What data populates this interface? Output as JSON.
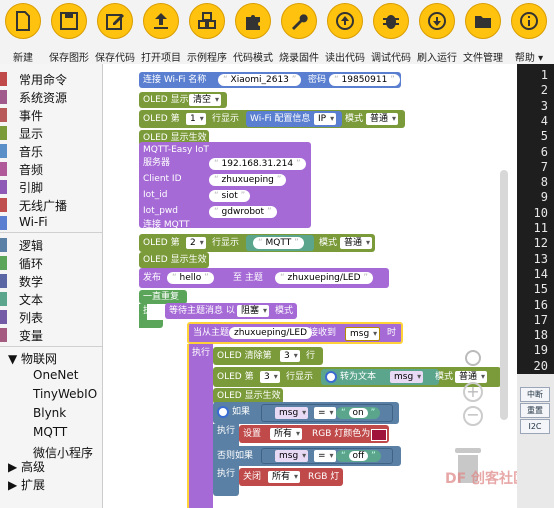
{
  "toolbar": {
    "buttons": [
      {
        "label": "新建",
        "icon": "new-file-icon"
      },
      {
        "label": "保存图形",
        "icon": "save-icon"
      },
      {
        "label": "保存代码",
        "icon": "edit-icon"
      },
      {
        "label": "打开项目",
        "icon": "upload-icon"
      },
      {
        "label": "示例程序",
        "icon": "blocks-icon"
      },
      {
        "label": "代码模式",
        "icon": "puzzle-icon"
      },
      {
        "label": "烧录固件",
        "icon": "wrench-icon"
      },
      {
        "label": "读出代码",
        "icon": "circle-up-icon"
      },
      {
        "label": "调试代码",
        "icon": "bug-icon"
      },
      {
        "label": "刷入运行",
        "icon": "circle-down-icon"
      },
      {
        "label": "文件管理",
        "icon": "folder-icon"
      },
      {
        "label": "帮助 ▾",
        "icon": "info-icon"
      }
    ]
  },
  "sidebar": {
    "categories": [
      {
        "label": "常用命令",
        "color": "#c04a4a"
      },
      {
        "label": "系统资源",
        "color": "#a05a8c"
      },
      {
        "label": "事件",
        "color": "#b85a5a"
      },
      {
        "label": "显示",
        "color": "#7b9b3a"
      },
      {
        "label": "音乐",
        "color": "#5b8fc7"
      },
      {
        "label": "音频",
        "color": "#b05a9a"
      },
      {
        "label": "引脚",
        "color": "#8e5ab5"
      },
      {
        "label": "无线广播",
        "color": "#c05050"
      },
      {
        "label": "Wi-Fi",
        "color": "#5a7fd0"
      },
      {
        "label": "逻辑",
        "color": "#5b80a5"
      },
      {
        "label": "循环",
        "color": "#5ba55b"
      },
      {
        "label": "数学",
        "color": "#5b67a5"
      },
      {
        "label": "文本",
        "color": "#5ba58c"
      },
      {
        "label": "列表",
        "color": "#745ba5"
      },
      {
        "label": "变量",
        "color": "#a55b80"
      }
    ],
    "iot_group": "▼ 物联网",
    "iot_items": [
      "OneNet",
      "TinyWebIO",
      "Blynk",
      "MQTT",
      "微信小程序"
    ],
    "advanced": "▶ 高级",
    "extension": "▶ 扩展"
  },
  "blocks": {
    "wifi": {
      "label": "连接 Wi-Fi 名称",
      "ssid": "Xiaomi_2613",
      "pwd_label": "密码",
      "pwd": "19850911"
    },
    "oled_clear": {
      "label": "OLED 显示",
      "opt": "清空"
    },
    "oled_wifi": {
      "pre": "OLED 第",
      "line": "1",
      "mid": "行显示",
      "info": "Wi-Fi 配置信息",
      "ip": "IP",
      "mode_label": "模式",
      "mode": "普通"
    },
    "oled_apply1": "OLED 显示生效",
    "mqtt": {
      "title": "MQTT-Easy IoT",
      "server_label": "服务器",
      "server": "192.168.31.214",
      "client_label": "Client ID",
      "client": "zhuxueping",
      "iotid_label": "Iot_id",
      "iotid": "siot",
      "iotpwd_label": "Iot_pwd",
      "iotpwd": "gdwrobot",
      "connect": "连接 MQTT"
    },
    "oled_mqtt": {
      "pre": "OLED 第",
      "line": "2",
      "mid": "行显示",
      "text": "MQTT",
      "mode_label": "模式",
      "mode": "普通"
    },
    "oled_apply2": "OLED 显示生效",
    "publish": {
      "label": "发布",
      "msg": "hello",
      "mid": "至 主题",
      "topic": "zhuxueping/LED"
    },
    "forever": "一直重复",
    "exec": "执行",
    "wait": {
      "label": "等待主题消息 以",
      "mode": "阻塞",
      "suffix": "模式"
    },
    "on_msg": {
      "label": "当从主题",
      "topic": "zhuxueping/LED",
      "mid": "接收到",
      "var": "msg",
      "suffix": "时"
    },
    "exec2": "执行",
    "oled_clear_line": {
      "label": "OLED 清除第",
      "line": "3",
      "suffix": "行"
    },
    "oled_line3": {
      "pre": "OLED 第",
      "line": "3",
      "mid": "行显示",
      "conv": "转为文本",
      "var": "msg",
      "mode_label": "模式",
      "mode": "普通"
    },
    "oled_apply3": "OLED 显示生效",
    "if": {
      "label": "如果",
      "var": "msg",
      "op": "=",
      "val": "on"
    },
    "exec3": "执行",
    "set_rgb": {
      "label": "设置",
      "target": "所有",
      "text": "RGB 灯颜色为"
    },
    "elseif": {
      "label": "否则如果",
      "var": "msg",
      "op": "=",
      "val": "off"
    },
    "exec4": "执行",
    "off_rgb": {
      "label": "关闭",
      "target": "所有",
      "text": "RGB 灯"
    }
  },
  "right_panel": {
    "line_numbers": [
      "1",
      "2",
      "3",
      "4",
      "5",
      "6",
      "7",
      "8",
      "9",
      "10",
      "11",
      "12",
      "13",
      "14",
      "15",
      "16",
      "17",
      "18",
      "19",
      "20"
    ],
    "buttons": [
      "中断",
      "重置",
      "I2C"
    ]
  },
  "watermark": "DF  创客社区"
}
